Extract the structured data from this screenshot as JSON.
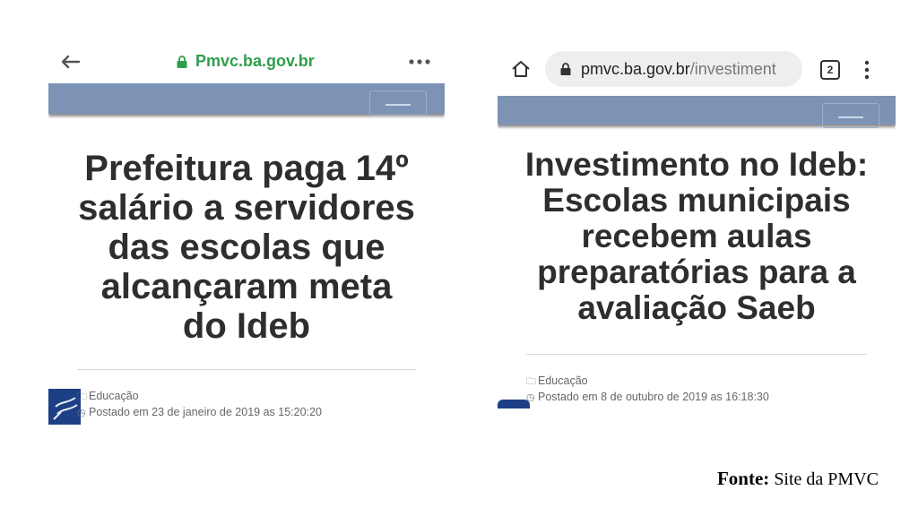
{
  "left": {
    "domain": "Pmvc.ba.gov.br",
    "headline": [
      "Prefeitura paga 14º",
      "salário a servidores",
      "das escolas que",
      "alcançaram meta",
      "do Ideb"
    ],
    "category": "Educação",
    "posted": "Postado em 23 de janeiro de 2019 as 15:20:20",
    "icons": [
      "back-arrow-icon",
      "lock-icon",
      "more-dots-icon",
      "folder-icon",
      "clock-icon"
    ],
    "accent": "#2e9e4d"
  },
  "right": {
    "url_domain": "pmvc.ba.gov.br",
    "url_path": "/investiment",
    "tab_count": "2",
    "headline": [
      "Investimento no Ideb:",
      "Escolas municipais",
      "recebem aulas",
      "preparatórias para a",
      "avaliação Saeb"
    ],
    "category": "Educação",
    "posted": "Postado em 8 de outubro de 2019 as 16:18:30",
    "icons": [
      "home-icon",
      "lock-icon",
      "tabs-icon",
      "kebab-menu-icon",
      "folder-icon",
      "clock-icon"
    ]
  },
  "caption": {
    "label": "Fonte:",
    "text": " Site da PMVC"
  },
  "colors": {
    "nav_band": "#7d93b5",
    "headline_text": "#2e2e2e",
    "logo_blue": "#1d3f86"
  }
}
